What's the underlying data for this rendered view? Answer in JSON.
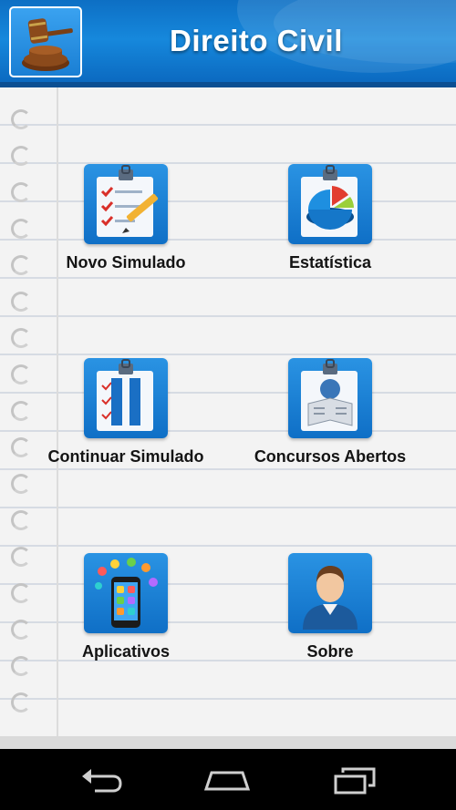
{
  "header": {
    "title": "Direito Civil",
    "logo_icon": "gavel-icon"
  },
  "menu": {
    "items": [
      {
        "label": "Novo Simulado",
        "icon": "checklist-pencil-icon"
      },
      {
        "label": "Estatística",
        "icon": "pie-chart-icon"
      },
      {
        "label": "Continuar Simulado",
        "icon": "pause-document-icon"
      },
      {
        "label": "Concursos Abertos",
        "icon": "newspaper-reader-icon"
      },
      {
        "label": "Aplicativos",
        "icon": "smartphone-apps-icon"
      },
      {
        "label": "Sobre",
        "icon": "person-avatar-icon"
      }
    ]
  },
  "navbar": {
    "back_icon": "back-icon",
    "home_icon": "home-icon",
    "recents_icon": "recent-apps-icon"
  },
  "colors": {
    "header_blue": "#1688dc",
    "tile_blue": "#1a7fd4",
    "nav_black": "#000000",
    "paper": "#f3f3f3"
  }
}
